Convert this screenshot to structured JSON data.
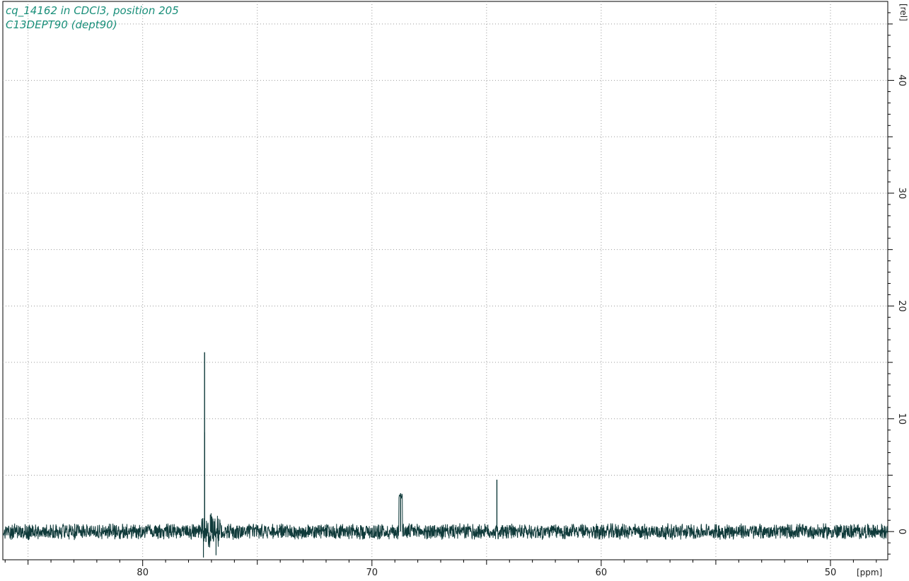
{
  "header": {
    "line1": "cq_14162 in CDCl3, position 205",
    "line2": "C13DEPT90 (dept90)"
  },
  "colors": {
    "trace": "#0f3a3a",
    "header_text": "#1a8f7a",
    "grid": "#9a9a9a",
    "axis": "#000000"
  },
  "chart_data": {
    "type": "line",
    "title": "",
    "xlabel": "[ppm]",
    "ylabel": "[rel]",
    "x_reversed": true,
    "xlim": [
      86.1,
      47.5
    ],
    "ylim": [
      -2.5,
      47
    ],
    "x_ticks": [
      80,
      70,
      60,
      50
    ],
    "y_ticks": [
      0,
      10,
      20,
      30,
      40
    ],
    "grid": true,
    "noise_amplitude": 0.6,
    "peaks": [
      {
        "ppm": 77.3,
        "intensity": 15.9,
        "note": "CDCl3 solvent line"
      },
      {
        "ppm": 77.3,
        "intensity": 8.8
      },
      {
        "ppm": 68.75,
        "intensity": 3.4
      },
      {
        "ppm": 64.55,
        "intensity": 4.6
      }
    ],
    "artifacts": [
      {
        "ppm": 77.35,
        "intensity": -2.3
      },
      {
        "ppm": 76.8,
        "intensity": -2.1
      },
      {
        "ppm": 77.05,
        "intensity": 1.5
      }
    ]
  }
}
